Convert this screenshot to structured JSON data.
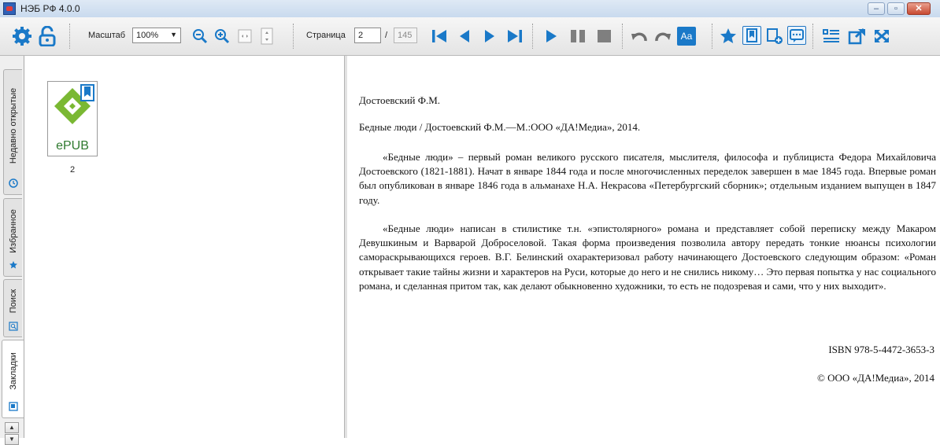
{
  "window": {
    "title": "НЭБ РФ 4.0.0",
    "minimize_glyph": "–",
    "restore_glyph": "▫",
    "close_glyph": "✕"
  },
  "toolbar": {
    "scale_label": "Масштаб",
    "scale_value": "100%",
    "page_label": "Страница",
    "page_current": "2",
    "page_separator": "/",
    "page_total": "145",
    "font_button_label": "Aa",
    "icons": [
      "gear-icon",
      "unlock-icon",
      "zoom-out-icon",
      "zoom-in-icon",
      "fit-width-icon",
      "fit-height-icon",
      "first-page-icon",
      "prev-page-icon",
      "next-page-icon",
      "last-page-icon",
      "play-icon",
      "pause-icon",
      "stop-icon",
      "undo-icon",
      "redo-icon",
      "font-icon",
      "star-icon",
      "bookmark-icon",
      "bookmark-add-icon",
      "comment-icon",
      "toc-icon",
      "external-window-icon",
      "fullscreen-icon"
    ],
    "accent_color": "#1a79c8"
  },
  "sidetabs": [
    {
      "label": "Недавно открытые",
      "icon": "clock-icon"
    },
    {
      "label": "Избранное",
      "icon": "star-icon"
    },
    {
      "label": "Поиск",
      "icon": "search-icon"
    },
    {
      "label": "Закладки",
      "icon": "bookmark-icon",
      "active": true
    }
  ],
  "bookmarks": {
    "items": [
      {
        "thumb_text": "ePUB",
        "page": "2",
        "icon": "epub-icon"
      }
    ]
  },
  "document": {
    "author": "Достоевский Ф.М.",
    "bibliography": "Бедные люди / Достоевский Ф.М.—М.:ООО «ДА!Медиа», 2014.",
    "paragraph1": "«Бедные люди» – первый роман великого русского писателя, мыслителя, философа и публициста Федора Михайловича Достоевского (1821-1881). Начат в январе 1844 года и после многочисленных переделок завершен в мае 1845 года. Впервые роман был опубликован в январе 1846 года в альманахе Н.А. Некрасова «Петербургский сборник»; отдельным изданием выпущен в 1847 году.",
    "paragraph2": "«Бедные люди» написан в стилистике т.н. «эпистолярного» романа и представляет собой переписку между Макаром Девушкиным и Варварой Доброселовой. Такая форма произведения позволила автору передать тонкие нюансы психологии самораскрывающихся героев. В.Г. Белинский охарактеризовал работу начинающего Достоевского следующим образом: «Роман открывает такие тайны жизни и характеров на Руси, которые до него и не снились никому… Это первая попытка у нас социального романа, и сделанная притом так, как делают обыкновенно художники, то есть не подозревая и сами, что у них выходит».",
    "isbn": "ISBN 978-5-4472-3653-3",
    "copyright": "© ООО «ДА!Медиа», 2014"
  }
}
